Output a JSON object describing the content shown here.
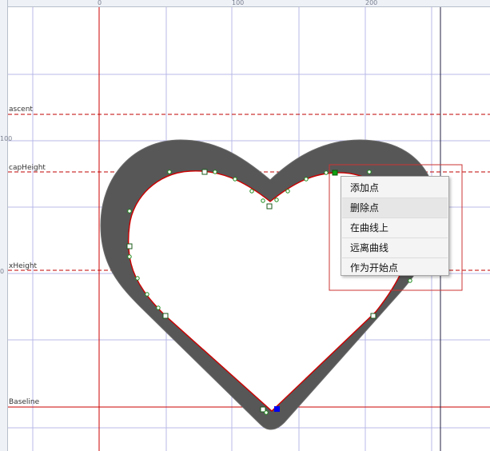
{
  "rulers": {
    "top_labels": [
      "0",
      "100",
      "200"
    ],
    "left_labels": [
      "100",
      "0"
    ]
  },
  "metrics": {
    "ascent": "ascent",
    "capHeight": "capHeight",
    "xHeight": "xHeight",
    "baseline": "Baseline"
  },
  "context_menu": {
    "items": [
      "添加点",
      "删除点",
      "在曲线上",
      "远离曲线",
      "作为开始点"
    ],
    "highlighted_index": 1
  },
  "colors": {
    "glyph_fill": "#575757",
    "outline": "#cc0000",
    "guide_red": "#d00000",
    "grid": "#b7b7e6",
    "selected_point": "#0000ee",
    "point": "#10a010"
  }
}
